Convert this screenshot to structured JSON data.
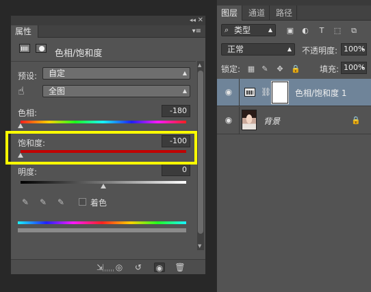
{
  "properties": {
    "tab_label": "属性",
    "collapse_glyph": "◂◂",
    "close_glyph": "✕",
    "menu_glyph": "▾≡",
    "title": "色相/饱和度",
    "preset_label": "预设:",
    "preset_value": "自定",
    "range_value": "全图",
    "hue_label": "色相:",
    "hue_value": "-180",
    "hue_level": 0.0,
    "saturation_label": "饱和度:",
    "saturation_value": "-100",
    "saturation_level": 0.0,
    "lightness_label": "明度:",
    "lightness_value": "0",
    "lightness_level": 0.5,
    "colorize_label": "着色",
    "colorize_checked": false
  },
  "layers": {
    "tabs": [
      "图层",
      "通道",
      "路径"
    ],
    "active_tab": 0,
    "filter_type": "类型",
    "blend_mode": "正常",
    "opacity_label": "不透明度:",
    "opacity_value": "100%",
    "lock_label": "锁定:",
    "fill_label": "填充:",
    "fill_value": "100%",
    "items": [
      {
        "name": "色相/饱和度 1",
        "type": "adjustment",
        "visible": true,
        "selected": true
      },
      {
        "name": "背景",
        "type": "image",
        "visible": true,
        "locked": true
      }
    ]
  },
  "colors": {
    "highlight_box": "#ffff00",
    "selected_layer": "#6f8499",
    "panel_bg": "#535353"
  },
  "icons": {
    "eyedroppers": [
      "eyedropper-icon",
      "eyedropper-plus-icon",
      "eyedropper-minus-icon"
    ],
    "footer": [
      "clip-to-layer-icon",
      "view-previous-icon",
      "reset-icon",
      "visibility-icon",
      "trash-icon"
    ]
  }
}
